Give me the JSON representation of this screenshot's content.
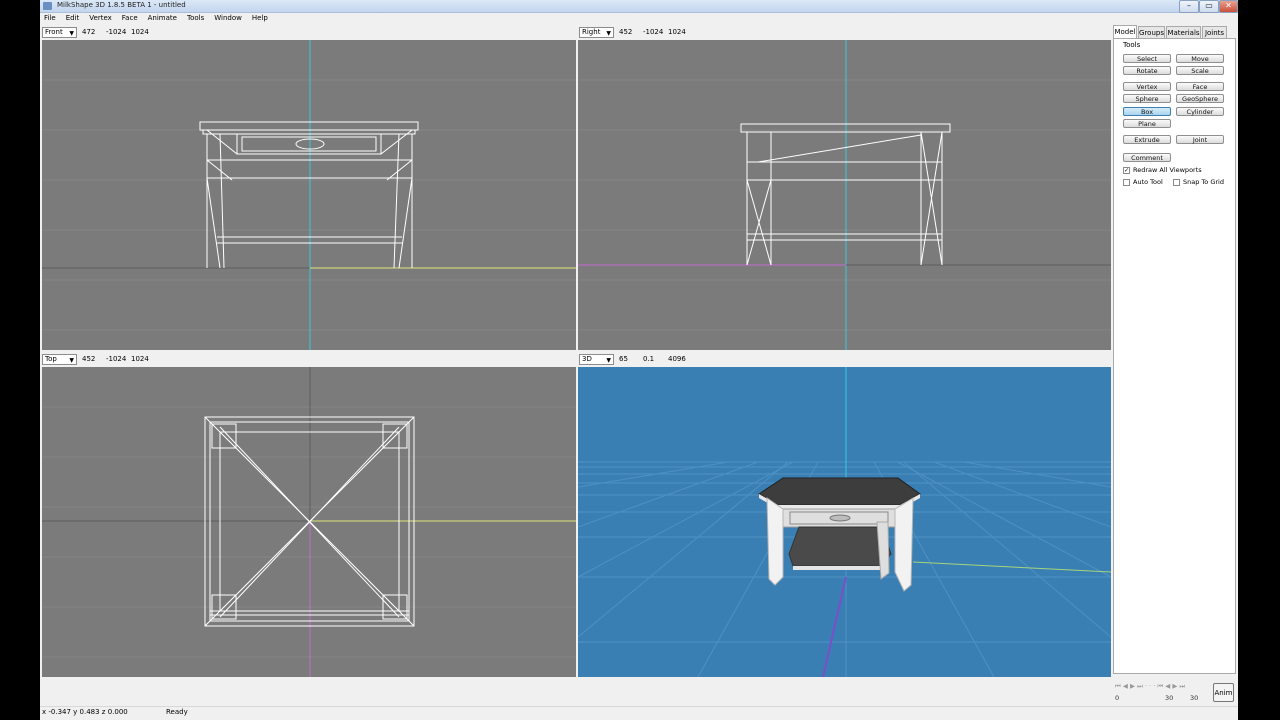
{
  "window": {
    "title": "MilkShape 3D 1.8.5 BETA 1 - untitled"
  },
  "menu": [
    "File",
    "Edit",
    "Vertex",
    "Face",
    "Animate",
    "Tools",
    "Window",
    "Help"
  ],
  "viewports": {
    "front": {
      "view": "Front",
      "v1": "472",
      "v2": "-1024",
      "v3": "1024"
    },
    "right": {
      "view": "Right",
      "v1": "452",
      "v2": "-1024",
      "v3": "1024"
    },
    "top": {
      "view": "Top",
      "v1": "452",
      "v2": "-1024",
      "v3": "1024"
    },
    "persp": {
      "view": "3D",
      "v1": "65",
      "v2": "0.1",
      "v3": "4096"
    }
  },
  "panel": {
    "tabs": [
      "Model",
      "Groups",
      "Materials",
      "Joints"
    ],
    "active_tab": "Model",
    "tools_label": "Tools",
    "buttons": {
      "select": "Select",
      "move": "Move",
      "rotate": "Rotate",
      "scale": "Scale",
      "vertex": "Vertex",
      "face": "Face",
      "sphere": "Sphere",
      "geosphere": "GeoSphere",
      "box": "Box",
      "cylinder": "Cylinder",
      "plane": "Plane",
      "extrude": "Extrude",
      "joint": "Joint",
      "comment": "Comment"
    },
    "pressed_tool": "Box",
    "checkboxes": {
      "redraw_all": {
        "label": "Redraw All Viewports",
        "checked": true
      },
      "auto_tool": {
        "label": "Auto Tool",
        "checked": false
      },
      "snap_to_grid": {
        "label": "Snap To Grid",
        "checked": false
      }
    }
  },
  "animation": {
    "frame_start": "0",
    "frame_end": "30",
    "current_frame": "30",
    "button": "Anim"
  },
  "status": {
    "coords": "x -0.347 y 0.483 z 0.000",
    "text": "Ready"
  },
  "colors": {
    "ortho_bg": "#7b7b7b",
    "persp_bg": "#3a7fb4",
    "wire": "#ffffff",
    "axis_y": "#3bd3f0",
    "axis_x": "#e9f08a",
    "axis_z": "#c76ad6"
  }
}
